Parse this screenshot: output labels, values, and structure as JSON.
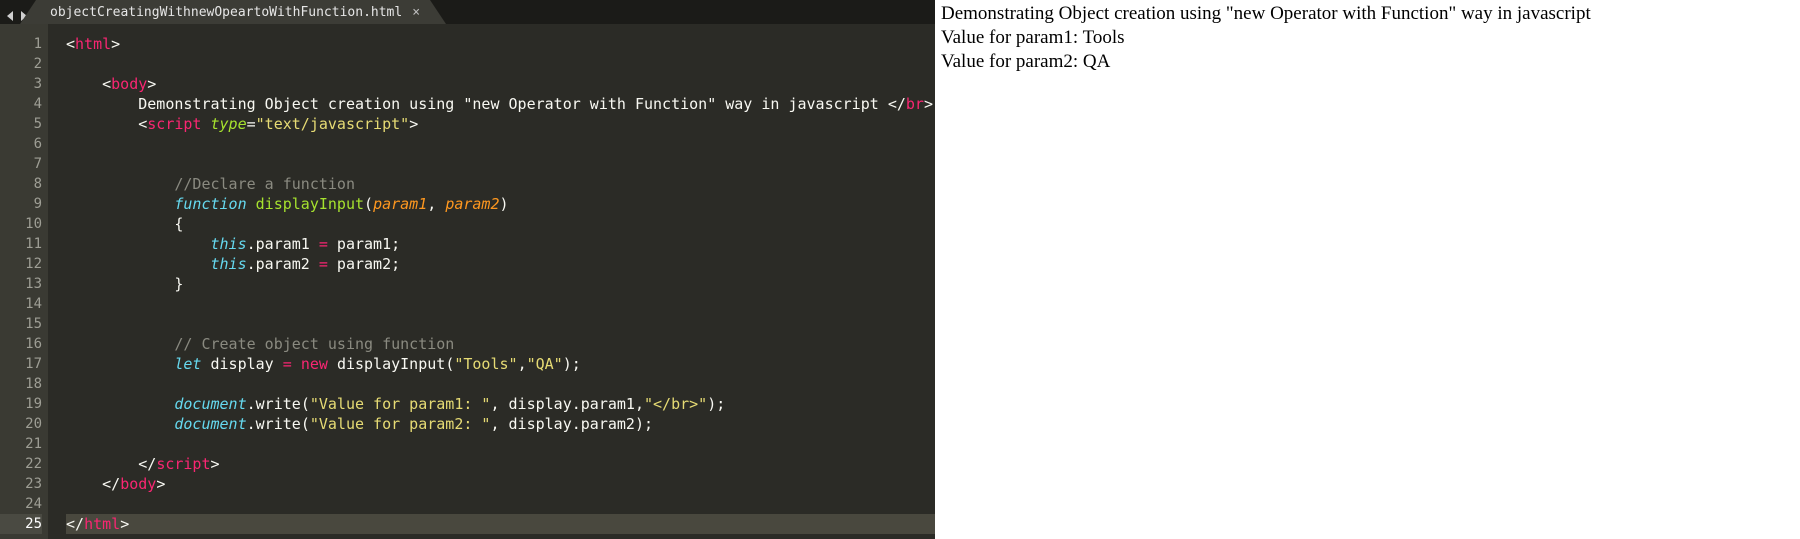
{
  "tab": {
    "filename": "objectCreatingWithnewOpeartoWithFunction.html",
    "close": "×"
  },
  "gutter": {
    "from": 1,
    "to": 25,
    "selected": 25
  },
  "code": {
    "l1_a": "<",
    "l1_tag": "html",
    "l1_b": ">",
    "l3_a": "<",
    "l3_tag": "body",
    "l3_b": ">",
    "l4_text": "Demonstrating Object creation using \"new Operator with Function\" way in javascript ",
    "l4_a": "</",
    "l4_tag": "br",
    "l4_b": ">",
    "l5_a": "<",
    "l5_tag": "script",
    "l5_sp": " ",
    "l5_attr": "type",
    "l5_eq": "=",
    "l5_str": "\"text/javascript\"",
    "l5_b": ">",
    "l8_cmt": "//Declare a function",
    "l9_kw": "function",
    "l9_sp": " ",
    "l9_fn": "displayInput",
    "l9_p1": "(",
    "l9_prm1": "param1",
    "l9_c": ", ",
    "l9_prm2": "param2",
    "l9_p2": ")",
    "l10": "{",
    "l11_this": "this",
    "l11_dot": ".",
    "l11_a": "param1 ",
    "l11_op": "=",
    "l11_b": " param1;",
    "l12_this": "this",
    "l12_dot": ".",
    "l12_a": "param2 ",
    "l12_op": "=",
    "l12_b": " param2;",
    "l13": "}",
    "l16_cmt": "// Create object using function",
    "l17_kw": "let",
    "l17_sp": " ",
    "l17_v": "display ",
    "l17_op": "=",
    "l17_sp2": " ",
    "l17_new": "new",
    "l17_sp3": " ",
    "l17_fn": "displayInput",
    "l17_args": "(",
    "l17_s1": "\"Tools\"",
    "l17_c": ",",
    "l17_s2": "\"QA\"",
    "l17_end": ");",
    "l19_obj": "document",
    "l19_dot": ".",
    "l19_fn": "write",
    "l19_p": "(",
    "l19_s1": "\"Value for param1: \"",
    "l19_c1": ", display.param1,",
    "l19_s2": "\"</br>\"",
    "l19_end": ");",
    "l20_obj": "document",
    "l20_dot": ".",
    "l20_fn": "write",
    "l20_p": "(",
    "l20_s1": "\"Value for param2: \"",
    "l20_c1": ", display.param2);",
    "l22_a": "</",
    "l22_tag": "script",
    "l22_b": ">",
    "l23_a": "</",
    "l23_tag": "body",
    "l23_b": ">",
    "l25_a": "</",
    "l25_tag": "html",
    "l25_b": ">"
  },
  "preview": {
    "line1": "Demonstrating Object creation using \"new Operator with Function\" way in javascript",
    "line2": "Value for param1: Tools",
    "line3": "Value for param2: QA"
  }
}
